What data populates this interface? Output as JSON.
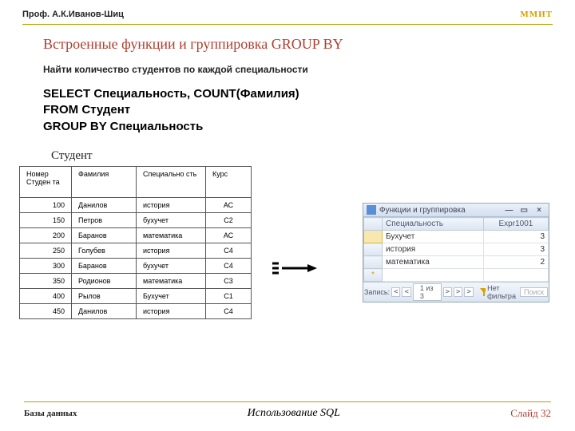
{
  "header": {
    "author": "Проф. А.К.Иванов-Шиц",
    "org": "ММИТ"
  },
  "title": "Встроенные функции и группировка  GROUP BY",
  "subtitle": "Найти количество студентов по каждой специальности",
  "sql": {
    "l1": "SELECT Специальность,  COUNT(Фамилия)",
    "l2": "FROM Студент",
    "l3": "GROUP BY Специальность"
  },
  "studentTable": {
    "caption": "Студент",
    "headers": [
      "Номер Студен та",
      "Фамилия",
      "Специально сть",
      "Курс"
    ],
    "rows": [
      [
        "100",
        "Данилов",
        "история",
        "АС"
      ],
      [
        "150",
        "Петров",
        "бухучет",
        "С2"
      ],
      [
        "200",
        "Баранов",
        "математика",
        "АС"
      ],
      [
        "250",
        "Голубев",
        "история",
        "С4"
      ],
      [
        "300",
        "Баранов",
        "бухучет",
        "С4"
      ],
      [
        "350",
        "Родионов",
        "математика",
        "С3"
      ],
      [
        "400",
        "Рылов",
        "Бухучет",
        "С1"
      ],
      [
        "450",
        "Данилов",
        "история",
        "С4"
      ]
    ]
  },
  "accessWindow": {
    "title": "Функции и группировка",
    "minIcon": "—",
    "maxIcon": "▭",
    "closeIcon": "×",
    "cols": [
      "",
      "Специальность",
      "Expr1001"
    ],
    "rows": [
      [
        "",
        "Бухучет",
        "3"
      ],
      [
        "",
        "история",
        "3"
      ],
      [
        "",
        "математика",
        "2"
      ]
    ],
    "nav": {
      "first": "<",
      "prev": "<",
      "pos": "1 из 3",
      "next": ">",
      "last": ">",
      "new": ">",
      "label": "Запись:",
      "filter": "Нет фильтра",
      "search": "Поиск"
    }
  },
  "footer": {
    "left": "Базы данных",
    "mid": "Использование SQL",
    "right": "Слайд 32"
  }
}
